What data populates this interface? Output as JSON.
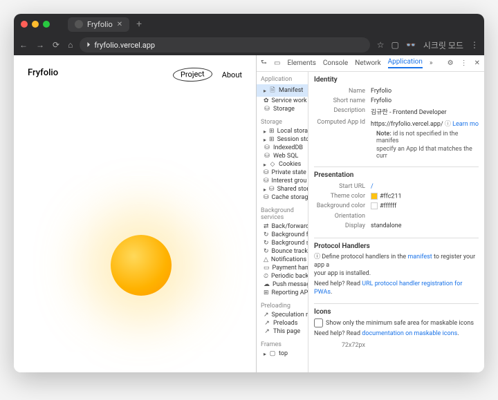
{
  "window": {
    "tabTitle": "Fryfolio",
    "urlDomain": "fryfolio.vercel.app",
    "incognitoLabel": "시크릿 모드"
  },
  "page": {
    "brand": "Fryfolio",
    "nav": {
      "project": "Project",
      "about": "About"
    }
  },
  "devtools": {
    "tabs": {
      "elements": "Elements",
      "console": "Console",
      "network": "Network",
      "application": "Application"
    },
    "sidebar": {
      "application": {
        "title": "Application",
        "items": [
          "Manifest",
          "Service work",
          "Storage"
        ]
      },
      "storage": {
        "title": "Storage",
        "items": [
          "Local storage",
          "Session stor",
          "IndexedDB",
          "Web SQL",
          "Cookies",
          "Private state",
          "Interest grou",
          "Shared stora",
          "Cache storag"
        ]
      },
      "background": {
        "title": "Background services",
        "items": [
          "Back/forward",
          "Background f",
          "Background s",
          "Bounce track",
          "Notifications",
          "Payment han",
          "Periodic back",
          "Push messag",
          "Reporting AP"
        ]
      },
      "preloading": {
        "title": "Preloading",
        "items": [
          "Speculation r",
          "Preloads",
          "This page"
        ]
      },
      "frames": {
        "title": "Frames",
        "items": [
          "top"
        ]
      }
    },
    "identity": {
      "heading": "Identity",
      "nameLabel": "Name",
      "name": "Fryfolio",
      "shortNameLabel": "Short name",
      "shortName": "Fryfolio",
      "descriptionLabel": "Description",
      "description": "김규란 - Frontend Developer",
      "appIdLabel": "Computed App Id",
      "appId": "https://fryfolio.vercel.app/",
      "learnMore": "Learn mo",
      "note1Prefix": "Note:",
      "note1": "id is not specified in the manifes",
      "note2": "specify an App Id that matches the curr"
    },
    "presentation": {
      "heading": "Presentation",
      "startUrlLabel": "Start URL",
      "startUrl": "/",
      "themeColorLabel": "Theme color",
      "themeColor": "#ffc211",
      "bgColorLabel": "Background color",
      "bgColor": "#ffffff",
      "orientationLabel": "Orientation",
      "displayLabel": "Display",
      "display": "standalone"
    },
    "protocol": {
      "heading": "Protocol Handlers",
      "text1a": "Define protocol handlers in the ",
      "manifestLink": "manifest",
      "text1b": " to register your app a",
      "text1c": "your app is installed.",
      "helpPrefix": "Need help? Read ",
      "helpLink": "URL protocol handler registration for PWAs"
    },
    "icons": {
      "heading": "Icons",
      "checkbox": "Show only the minimum safe area for maskable icons",
      "helpPrefix": "Need help? Read ",
      "helpLink": "documentation on maskable icons",
      "sizeLabel": "72x72px"
    }
  }
}
